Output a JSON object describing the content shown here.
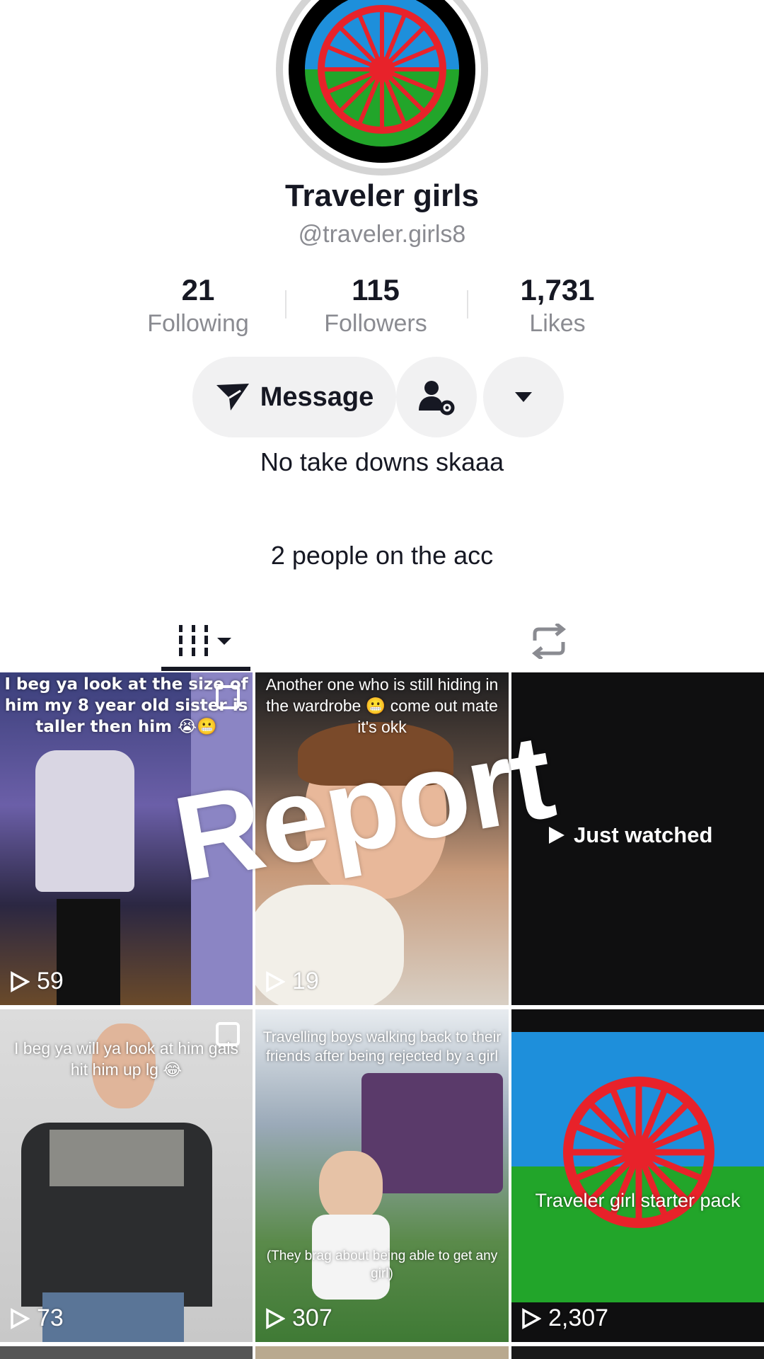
{
  "profile": {
    "display_name": "Traveler girls",
    "handle": "@traveler.girls8",
    "avatar_icon": "romani-flag-avatar"
  },
  "stats": [
    {
      "value": "21",
      "label": "Following"
    },
    {
      "value": "115",
      "label": "Followers"
    },
    {
      "value": "1,731",
      "label": "Likes"
    }
  ],
  "actions": {
    "message_label": "Message",
    "message_icon": "send-icon",
    "follow_manage_icon": "user-settings-icon",
    "more_icon": "caret-down-icon"
  },
  "bio": {
    "line1": "No take downs skaaa",
    "line2": "2 people on the acc"
  },
  "tabs": [
    {
      "icon": "videos-grid-icon",
      "active": true
    },
    {
      "icon": "repost-icon",
      "active": false
    }
  ],
  "overlay": {
    "report_text": "Report",
    "just_watched": "Just watched"
  },
  "videos": [
    {
      "caption": "I beg ya look at the size of him my 8 year old sister is taller then him 😭😬",
      "views": "59",
      "pinned": true
    },
    {
      "caption": "Another one who is still hiding in the wardrobe 😬 come out mate it's okk",
      "views": "19",
      "pinned": false
    },
    {
      "caption": "",
      "views": "",
      "pinned": false,
      "just_watched": true
    },
    {
      "caption": "I beg ya will ya look at him gals hit him up lg 😂",
      "views": "73",
      "pinned": true
    },
    {
      "caption": "Travelling boys walking back to their friends after being rejected by a girl",
      "caption2": "(They brag about being able to get any girl)",
      "views": "307",
      "pinned": false
    },
    {
      "caption": "Traveler girl starter pack",
      "views": "2,307",
      "pinned": false
    }
  ],
  "colors": {
    "flag_blue": "#1e8fdb",
    "flag_green": "#22a52a",
    "flag_red": "#e8222a",
    "text_primary": "#161823",
    "text_secondary": "#8a8b91"
  }
}
